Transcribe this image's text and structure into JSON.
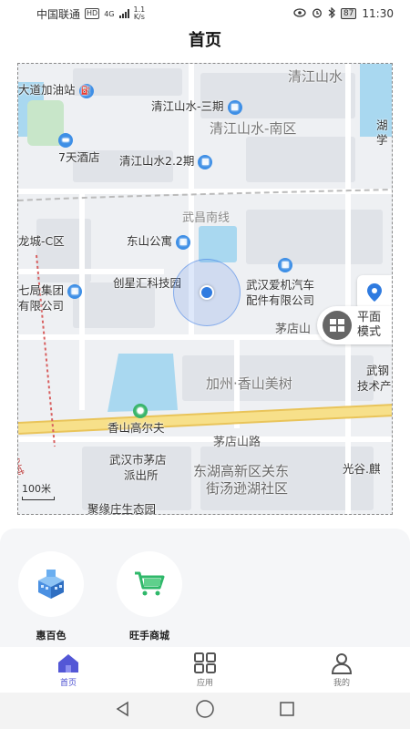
{
  "status_bar": {
    "carrier": "中国联通",
    "hd": "HD",
    "network": "4G",
    "speed_value": "1.1",
    "speed_unit": "K/s",
    "battery": "87",
    "time": "11:30"
  },
  "header": {
    "title": "首页"
  },
  "map": {
    "labels": {
      "gas_station": "大道加油站",
      "qjss_3": "清江山水-三期",
      "qjss": "清江山水",
      "qjss_south": "清江山水-南区",
      "hu_xue": "湖\n学",
      "hotel_7days": "7天酒店",
      "qjss_22": "清江山水2.2期",
      "wuchang_south_line": "武昌南线",
      "city_c": "龙城-C区",
      "dongshan": "东山公寓",
      "qiju_group": "七局集团",
      "co_ltd": "有限公司",
      "chuangxinghui": "创星汇科技园",
      "wuhan_aiji": "武汉爱机汽车",
      "parts_co": "配件有限公司",
      "maodian_road_1": "茅店山",
      "jiazhou": "加州·香山美树",
      "wugang": "武钢",
      "tech": "技术产",
      "xiangshan_golf": "香山高尔夫",
      "maodian_road_2": "茅店山路",
      "wuxian_road": "武咸城",
      "maodian_station_1": "武汉市茅店",
      "maodian_station_2": "派出所",
      "donghu_1": "东湖高新区关东",
      "donghu_2": "街汤逊湖社区",
      "guanggu": "光谷.麒",
      "juyuanzhuang": "聚缘庄生态园"
    },
    "mode_button": "平面\n模式",
    "scale": "100米"
  },
  "apps": [
    {
      "label": "惠百色",
      "icon": "building-icon"
    },
    {
      "label": "旺手商城",
      "icon": "shopping-cart-icon"
    }
  ],
  "tabs": [
    {
      "label": "首页",
      "icon": "home-icon",
      "active": true
    },
    {
      "label": "应用",
      "icon": "grid-icon",
      "active": false
    },
    {
      "label": "我的",
      "icon": "user-icon",
      "active": false
    }
  ],
  "colors": {
    "accent": "#4a4ed0",
    "map_water": "#a9d8f0",
    "map_road_yellow": "#f7e08a",
    "location_blue": "#2f7be0"
  }
}
